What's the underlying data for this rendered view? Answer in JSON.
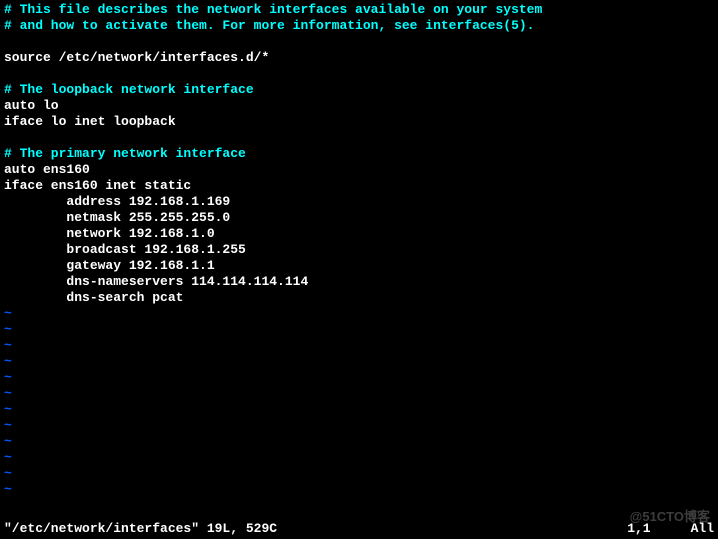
{
  "lines": [
    {
      "type": "comment",
      "text": "# This file describes the network interfaces available on your system"
    },
    {
      "type": "comment",
      "text": "# and how to activate them. For more information, see interfaces(5)."
    },
    {
      "type": "normal",
      "text": ""
    },
    {
      "type": "normal",
      "text": "source /etc/network/interfaces.d/*"
    },
    {
      "type": "normal",
      "text": ""
    },
    {
      "type": "comment",
      "text": "# The loopback network interface"
    },
    {
      "type": "normal",
      "text": "auto lo"
    },
    {
      "type": "normal",
      "text": "iface lo inet loopback"
    },
    {
      "type": "normal",
      "text": ""
    },
    {
      "type": "comment",
      "text": "# The primary network interface"
    },
    {
      "type": "normal",
      "text": "auto ens160"
    },
    {
      "type": "normal",
      "text": "iface ens160 inet static"
    },
    {
      "type": "normal",
      "text": "        address 192.168.1.169"
    },
    {
      "type": "normal",
      "text": "        netmask 255.255.255.0"
    },
    {
      "type": "normal",
      "text": "        network 192.168.1.0"
    },
    {
      "type": "normal",
      "text": "        broadcast 192.168.1.255"
    },
    {
      "type": "normal",
      "text": "        gateway 192.168.1.1"
    },
    {
      "type": "normal",
      "text": "        dns-nameservers 114.114.114.114"
    },
    {
      "type": "normal",
      "text": "        dns-search pcat"
    }
  ],
  "tilde_char": "~",
  "tilde_count": 12,
  "status": {
    "filename": "\"/etc/network/interfaces\" 19L, 529C",
    "position": "1,1",
    "view": "All"
  },
  "watermark": "@51CTO博客"
}
